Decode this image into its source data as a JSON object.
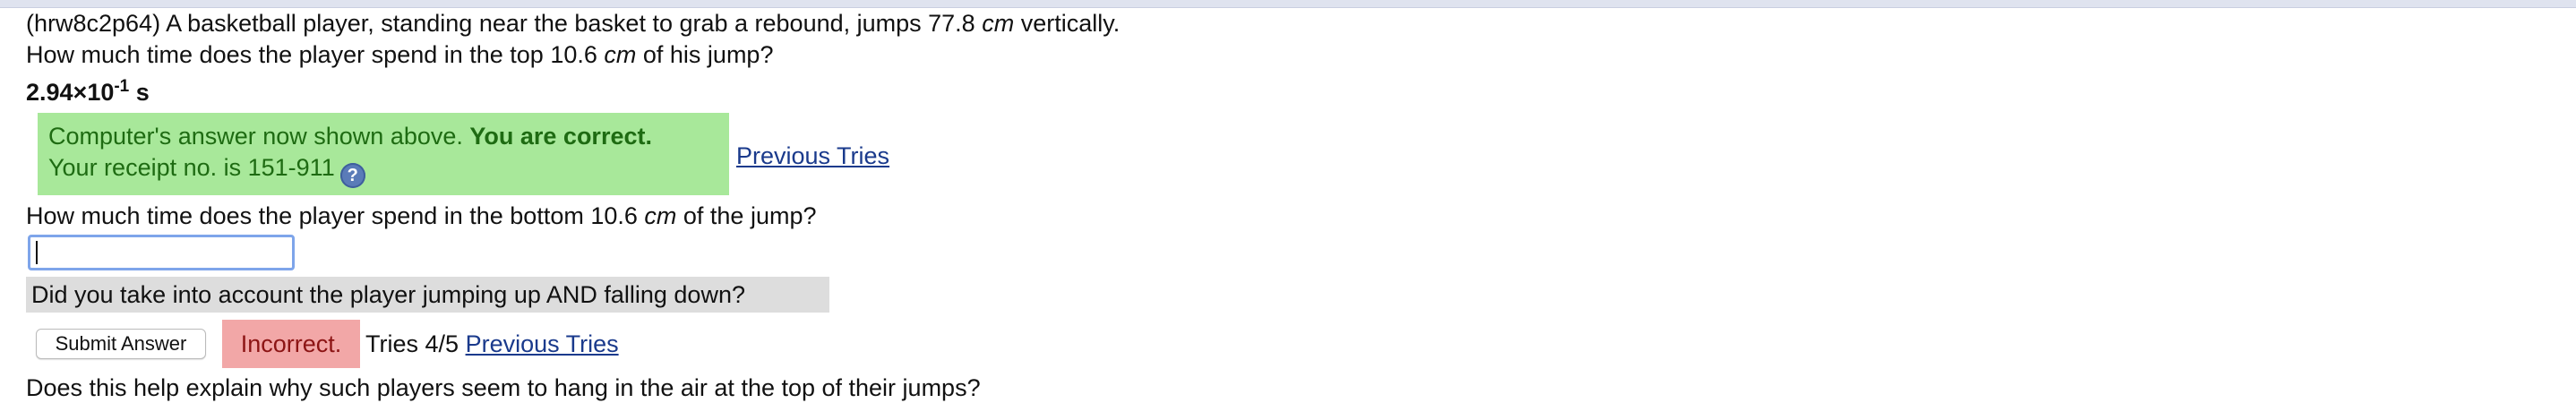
{
  "problem": {
    "id": "(hrw8c2p64)",
    "statement_a": " A basketball player, standing near the basket to grab a rebound, jumps 77.8 ",
    "unit_cm": "cm",
    "statement_b": " vertically.",
    "q1_a": "How much time does the player spend in the top 10.6 ",
    "q1_b": " of his jump?",
    "q2_a": "How much time does the player spend in the bottom 10.6 ",
    "q2_b": " of the jump?",
    "followup": "Does this help explain why such players seem to hang in the air at the top of their jumps?"
  },
  "part1": {
    "answer_mantissa": "2.94×10",
    "answer_exponent": "-1",
    "answer_unit": " s",
    "status_text": "Computer's answer now shown above. ",
    "status_bold": "You are correct.",
    "receipt_text": "Your receipt no. is 151-911",
    "help_icon": "?",
    "previous_tries": "Previous Tries"
  },
  "part2": {
    "input_value": "",
    "hint": "Did you take into account the player jumping up AND falling down?",
    "submit_label": "Submit Answer",
    "result": "Incorrect.",
    "tries": "Tries 4/5",
    "previous_tries": "Previous Tries"
  },
  "colors": {
    "correct_bg": "#a8e89a",
    "correct_text": "#1e6b12",
    "incorrect_bg": "#f2a7a7",
    "hint_bg": "#dddddd",
    "link": "#1a3a8c"
  }
}
